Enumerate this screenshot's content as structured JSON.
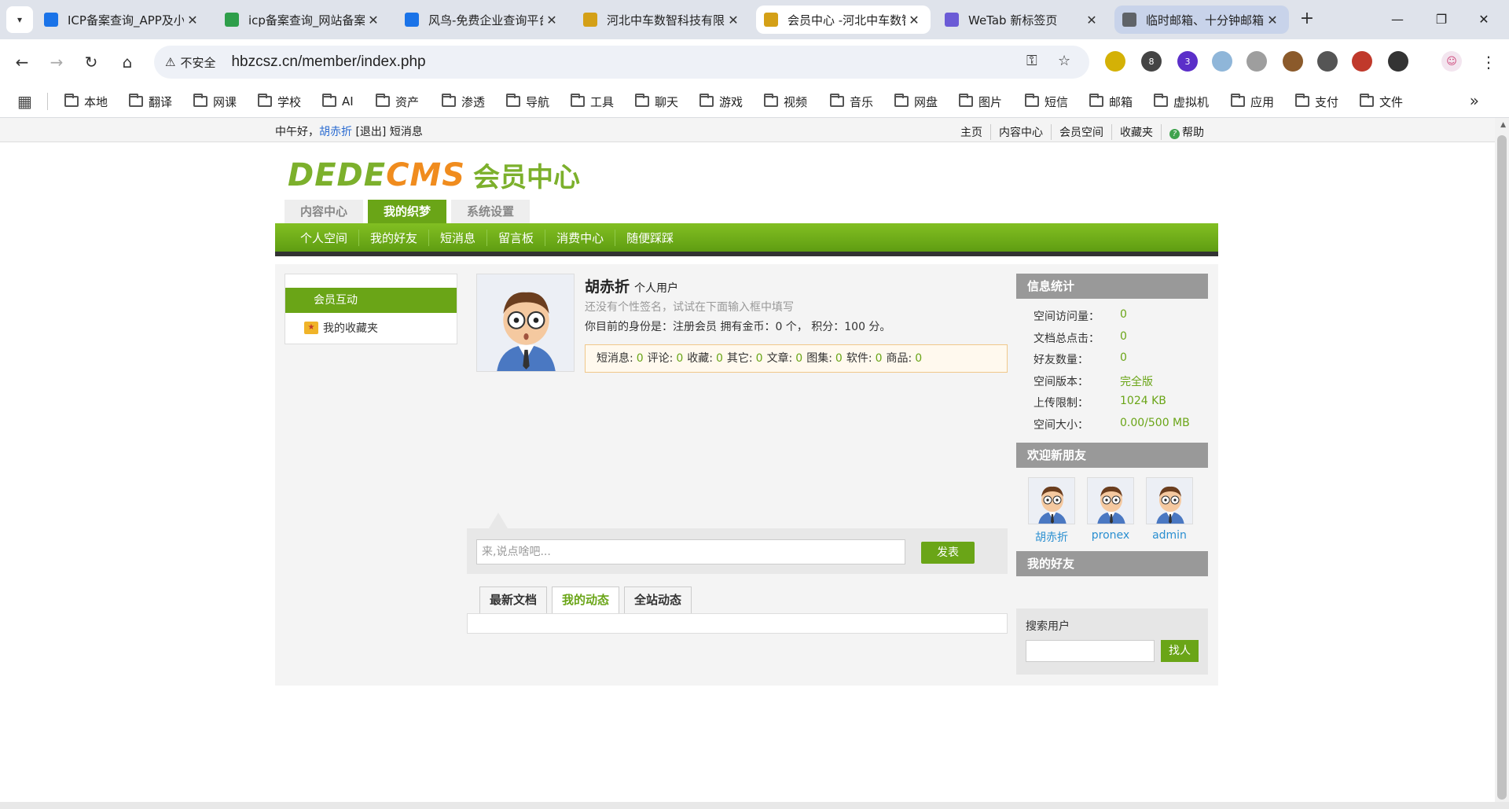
{
  "browser": {
    "tabs": [
      {
        "title": "ICP备案查询_APP及小程序",
        "favicon_color": "#1a73e8",
        "state": "normal"
      },
      {
        "title": "icp备案查询_网站备案",
        "favicon_color": "#2e9e4a",
        "state": "normal"
      },
      {
        "title": "风鸟-免费企业查询平台",
        "favicon_color": "#1a73e8",
        "state": "normal"
      },
      {
        "title": "河北中车数智科技有限公司",
        "favicon_color": "#d4a017",
        "state": "normal"
      },
      {
        "title": "会员中心 -河北中车数智",
        "favicon_color": "#d4a017",
        "state": "active"
      },
      {
        "title": "WeTab 新标签页",
        "favicon_color": "#6b5bd6",
        "state": "normal"
      },
      {
        "title": "临时邮箱、十分钟邮箱",
        "favicon_color": "#5f6368",
        "state": "highlight"
      }
    ],
    "address": {
      "warning": "不安全",
      "url": "hbzcsz.cn/member/index.php"
    },
    "extensions": [
      {
        "icon": "coin-icon",
        "color": "#d4b106",
        "badge": ""
      },
      {
        "icon": "puzzle-bot-icon",
        "color": "#444444",
        "badge": "8"
      },
      {
        "icon": "graduation-icon",
        "color": "#5b2fc9",
        "badge": "3"
      },
      {
        "icon": "hourglass-icon",
        "color": "#8fb6d9",
        "badge": ""
      },
      {
        "icon": "bars-icon",
        "color": "#9e9e9e",
        "badge": ""
      },
      {
        "icon": "cookie-icon",
        "color": "#8b5a2b",
        "badge": ""
      },
      {
        "icon": "hat-icon",
        "color": "#555555",
        "badge": ""
      },
      {
        "icon": "o-icon",
        "color": "#c0392b",
        "badge": ""
      },
      {
        "icon": "extensions-icon",
        "color": "#333333",
        "badge": ""
      }
    ],
    "bookmarks": [
      "本地",
      "翻译",
      "网课",
      "学校",
      "AI",
      "资产",
      "渗透",
      "导航",
      "工具",
      "聊天",
      "游戏",
      "视频",
      "音乐",
      "网盘",
      "图片",
      "短信",
      "邮箱",
      "虚拟机",
      "应用",
      "支付",
      "文件"
    ]
  },
  "site": {
    "topbar": {
      "greeting": "中午好，",
      "username": "胡赤折",
      "logout": "[退出]",
      "messages": "短消息",
      "links": [
        "主页",
        "内容中心",
        "会员空间",
        "收藏夹",
        "帮助"
      ]
    },
    "logo": {
      "part1": "DEDE",
      "part2": "CMS",
      "part3": "会员中心"
    },
    "main_tabs": [
      {
        "label": "内容中心",
        "active": false
      },
      {
        "label": "我的织梦",
        "active": true
      },
      {
        "label": "系统设置",
        "active": false
      }
    ],
    "sub_nav": [
      "个人空间",
      "我的好友",
      "短消息",
      "留言板",
      "消费中心",
      "随便踩踩"
    ],
    "left_menu": {
      "active": "会员互动",
      "item": "我的收藏夹"
    },
    "profile": {
      "name": "胡赤折",
      "role": "个人用户",
      "signature": "还没有个性签名，试试在下面输入框中填写",
      "status": "你目前的身份是：注册会员 拥有金币：0 个， 积分：100 分。",
      "stats": [
        {
          "label": "短消息:",
          "value": "0"
        },
        {
          "label": "评论:",
          "value": "0"
        },
        {
          "label": "收藏:",
          "value": "0"
        },
        {
          "label": "其它:",
          "value": "0"
        },
        {
          "label": "文章:",
          "value": "0"
        },
        {
          "label": "图集:",
          "value": "0"
        },
        {
          "label": "软件:",
          "value": "0"
        },
        {
          "label": "商品:",
          "value": "0"
        }
      ]
    },
    "post": {
      "placeholder": "来,说点啥吧...",
      "button": "发表"
    },
    "feed_tabs": [
      {
        "label": "最新文档",
        "active": false
      },
      {
        "label": "我的动态",
        "active": true
      },
      {
        "label": "全站动态",
        "active": false
      }
    ],
    "info_panel": {
      "title": "信息统计",
      "rows": [
        {
          "k": "空间访问量：",
          "v": "0"
        },
        {
          "k": "文档总点击：",
          "v": "0"
        },
        {
          "k": "好友数量：",
          "v": "0"
        },
        {
          "k": "空间版本：",
          "v": "完全版"
        },
        {
          "k": "上传限制：",
          "v": "1024 KB"
        },
        {
          "k": "空间大小：",
          "v": "0.00/500 MB"
        }
      ]
    },
    "welcome_panel": {
      "title": "欢迎新朋友",
      "friends": [
        "胡赤折",
        "pronex",
        "admin"
      ]
    },
    "friends_panel": {
      "title": "我的好友"
    },
    "search": {
      "label": "搜索用户",
      "button": "找人"
    }
  },
  "colors": {
    "accent": "#6aa517",
    "orange": "#f08c1e",
    "panel_gray": "#999999"
  }
}
